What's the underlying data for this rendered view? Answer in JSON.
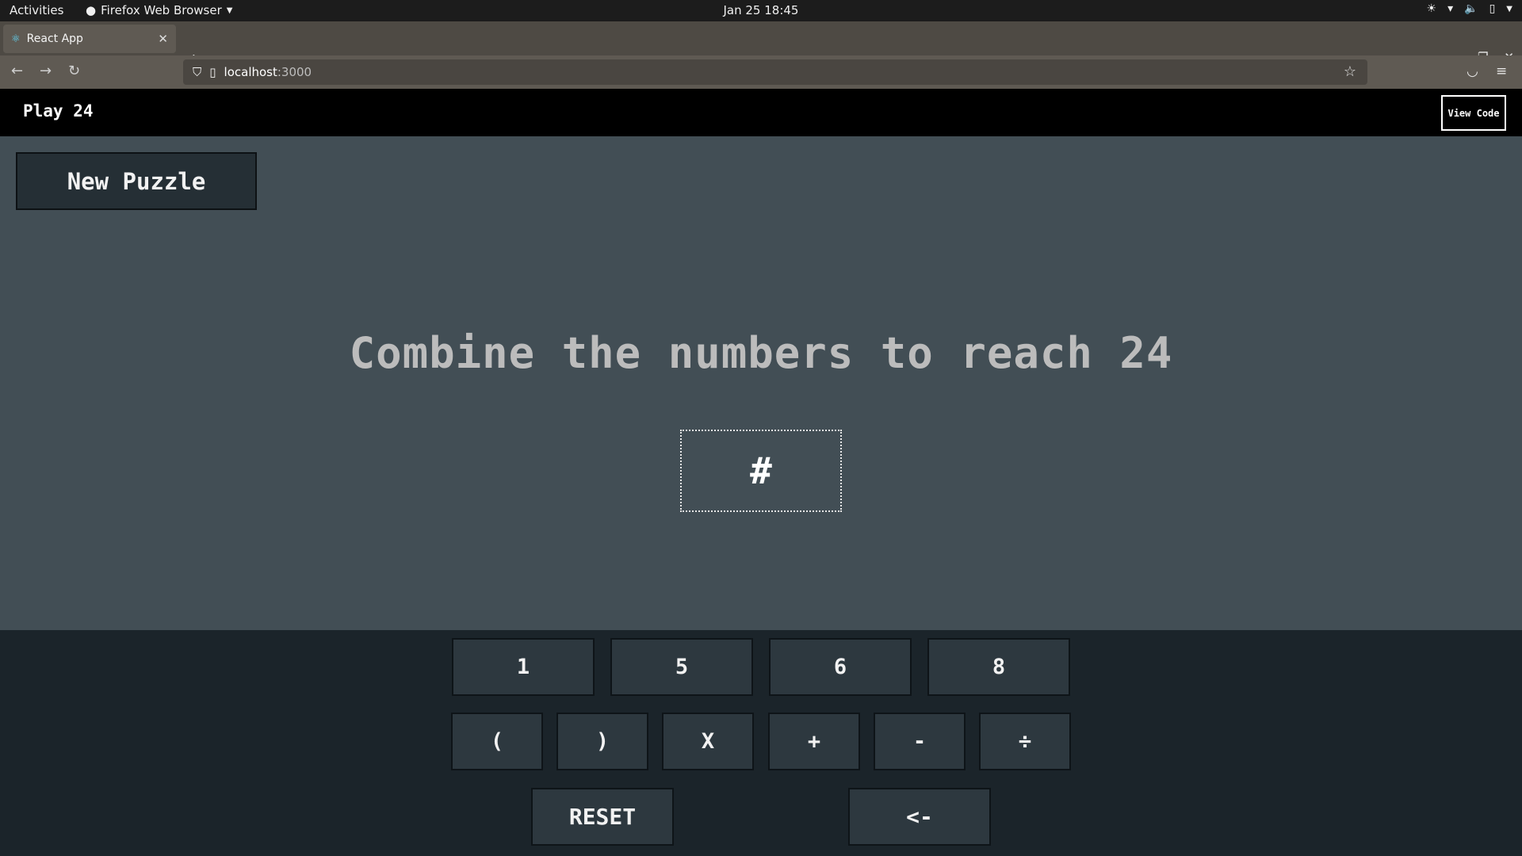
{
  "system": {
    "activities": "Activities",
    "app_name": "Firefox Web Browser",
    "clock": "Jan 25  18:45"
  },
  "browser": {
    "tab_title": "React App",
    "url_host": "localhost",
    "url_port": ":3000"
  },
  "app": {
    "title": "Play 24",
    "view_code": "View Code",
    "new_puzzle": "New Puzzle",
    "instruction": "Combine the numbers to reach 24",
    "answer_placeholder": "#",
    "numbers": [
      "1",
      "5",
      "6",
      "8"
    ],
    "operators": [
      "(",
      ")",
      "X",
      "+",
      "-",
      "÷"
    ],
    "reset": "RESET",
    "backspace": "<-"
  }
}
